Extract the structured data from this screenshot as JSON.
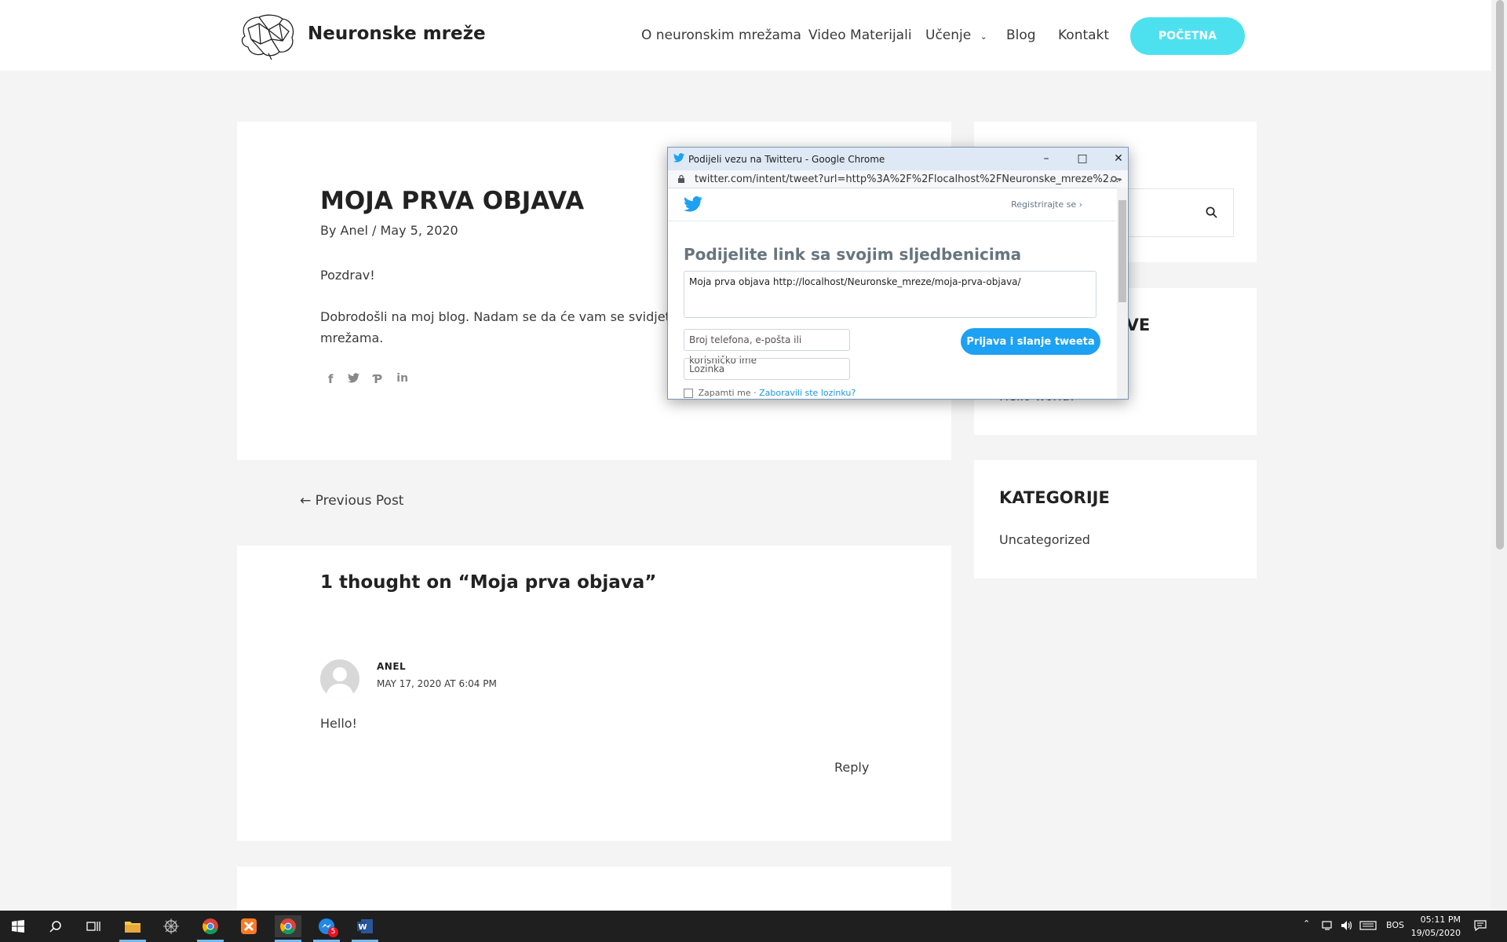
{
  "site": {
    "title": "Neuronske mreže",
    "nav": [
      {
        "label": "O neuronskim mrežama"
      },
      {
        "label": "Video Materijali"
      },
      {
        "label": "Učenje"
      },
      {
        "label": "Blog"
      },
      {
        "label": "Kontakt"
      }
    ],
    "cta": "POČETNA"
  },
  "post": {
    "title": "MOJA PRVA OBJAVA",
    "meta_by": "By",
    "author": "Anel",
    "meta_sep": "/",
    "date": "May 5, 2020",
    "p1": "Pozdrav!",
    "p2_line1": "Dobrodošli na moj blog. Nadam se da će vam se svidjeti. Pr",
    "p2_line2": "mrežama.",
    "share": [
      "facebook-icon",
      "twitter-icon",
      "pinterest-icon",
      "linkedin-icon"
    ]
  },
  "navigation": {
    "prev": "← Previous Post"
  },
  "comments": {
    "title": "1 thought on “Moja prva objava”",
    "items": [
      {
        "author": "ANEL",
        "date": "MAY 17, 2020 AT 6:04 PM",
        "text": "Hello!",
        "reply": "Reply"
      }
    ]
  },
  "sidebar": {
    "recent_title_partial": "JAVE",
    "recent_item": "Hello world!",
    "categories_title": "KATEGORIJE",
    "categories": [
      "Uncategorized"
    ]
  },
  "popup": {
    "window_title": "Podijeli vezu na Twitteru - Google Chrome",
    "url": "twitter.com/intent/tweet?url=http%3A%2F%2Flocalhost%2FNeuronske_mreze%2...",
    "register": "Registrirajte se ›",
    "heading": "Podijelite link sa svojim sljedbenicima",
    "tweet_text": "Moja prva objava http://localhost/Neuronske_mreze/moja-prva-objava/",
    "user_placeholder": "Broj telefona, e-pošta ili korisničko ime",
    "password_placeholder": "Lozinka",
    "submit": "Prijava i slanje tweeta",
    "remember": "Zapamti me",
    "remember_sep": " · ",
    "forgot": "Zaboravili ste lozinku?"
  },
  "taskbar": {
    "lang": "BOS",
    "time": "05:11 PM",
    "date": "19/05/2020",
    "badge": "5"
  },
  "colors": {
    "accent": "#4de1f0",
    "twitter": "#1da1f2"
  }
}
